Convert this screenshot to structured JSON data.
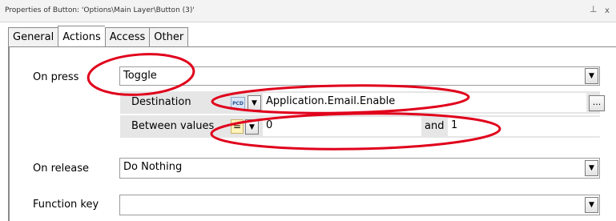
{
  "window": {
    "title": "Properties of Button: 'Options\\Main Layer\\Button (3)'",
    "pin_glyph": "⊥",
    "close_glyph": "x"
  },
  "tabs": [
    {
      "label": "General",
      "active": false
    },
    {
      "label": "Actions",
      "active": true
    },
    {
      "label": "Access",
      "active": false
    },
    {
      "label": "Other",
      "active": false
    }
  ],
  "on_press": {
    "label": "On press",
    "value": "Toggle",
    "destination": {
      "label": "Destination",
      "badge": "PCD",
      "value": "Application.Email.Enable",
      "browse": "..."
    },
    "between": {
      "label": "Between values",
      "operator": "=",
      "from": "0",
      "and_label": "and",
      "to": "1"
    }
  },
  "on_release": {
    "label": "On release",
    "value": "Do Nothing"
  },
  "function_key": {
    "label": "Function key",
    "value": ""
  },
  "icons": {
    "dropdown": "▼"
  },
  "annotation_color": "#e0001b"
}
